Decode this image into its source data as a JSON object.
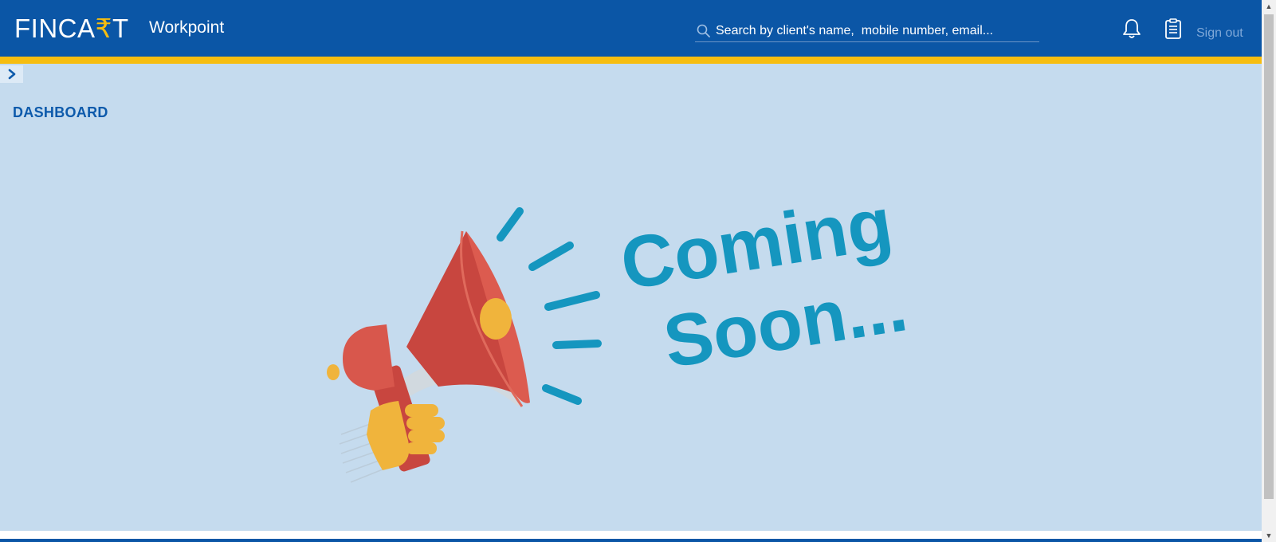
{
  "header": {
    "logo_text_left": "FINCA",
    "logo_text_rupee": "₹",
    "logo_text_right": "T",
    "app_name": "Workpoint",
    "search_placeholder": "Search by client's name,  mobile number, email...",
    "signout_label": "Sign out"
  },
  "main": {
    "page_title": "DASHBOARD",
    "banner_line1": "Coming",
    "banner_line2": "Soon..."
  },
  "colors": {
    "topbar": "#0b56a6",
    "accent_strip": "#f6bd10",
    "page_background": "#c5dbee",
    "title": "#0d5aab",
    "banner_text": "#1596bf"
  }
}
